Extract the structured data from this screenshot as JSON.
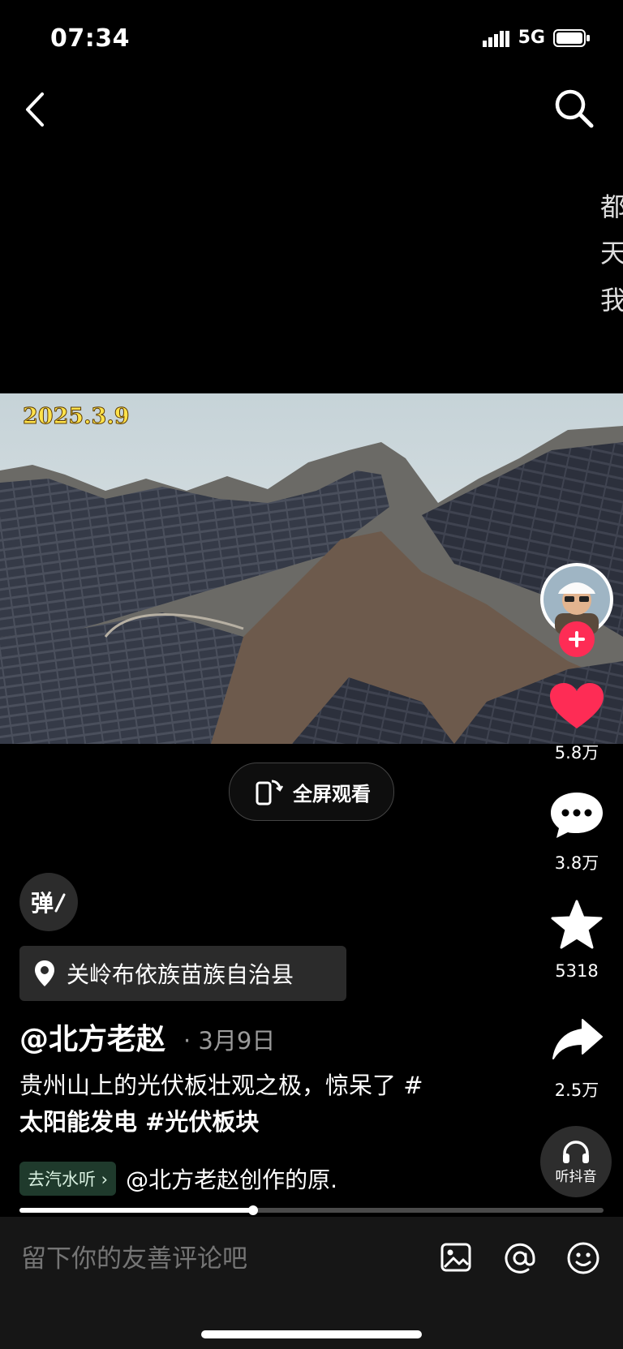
{
  "status_bar": {
    "time": "07:34",
    "network": "5G"
  },
  "side_overlay": [
    "都",
    "天",
    "我"
  ],
  "video": {
    "date_stamp": "2025.3.9"
  },
  "fullscreen_button": {
    "label": "全屏观看"
  },
  "rail": {
    "like_count": "5.8万",
    "comment_count": "3.8万",
    "favorite_count": "5318",
    "share_count": "2.5万",
    "listen_label": "听抖音"
  },
  "danmu": {
    "label": "弹"
  },
  "location": {
    "label": "关岭布依族苗族自治县"
  },
  "post": {
    "author": "@北方老赵",
    "date": "· 3月9日",
    "caption_text": "贵州山上的光伏板壮观之极，惊呆了 #",
    "caption_tags": "太阳能发电 #光伏板块"
  },
  "music": {
    "chip": "去汽水听 ›",
    "text": "@北方老赵创作的原."
  },
  "playback": {
    "progress": 0.4
  },
  "comment": {
    "placeholder": "留下你的友善评论吧"
  },
  "colors": {
    "accent": "#fe2c55",
    "background": "#000000",
    "chip": "#1f3a2c"
  }
}
